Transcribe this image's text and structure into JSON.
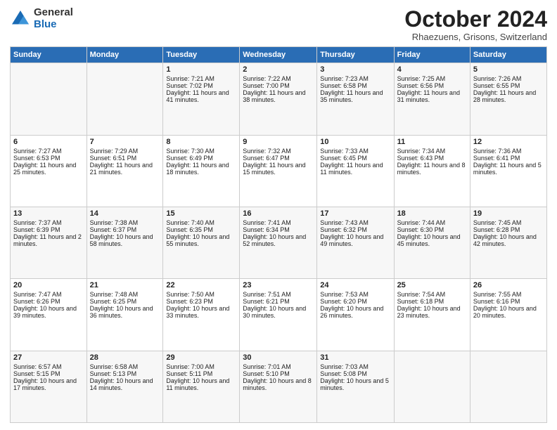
{
  "logo": {
    "general": "General",
    "blue": "Blue"
  },
  "title": "October 2024",
  "subtitle": "Rhaezuens, Grisons, Switzerland",
  "days_header": [
    "Sunday",
    "Monday",
    "Tuesday",
    "Wednesday",
    "Thursday",
    "Friday",
    "Saturday"
  ],
  "weeks": [
    [
      {
        "day": "",
        "info": ""
      },
      {
        "day": "",
        "info": ""
      },
      {
        "day": "1",
        "info": "Sunrise: 7:21 AM\nSunset: 7:02 PM\nDaylight: 11 hours and 41 minutes."
      },
      {
        "day": "2",
        "info": "Sunrise: 7:22 AM\nSunset: 7:00 PM\nDaylight: 11 hours and 38 minutes."
      },
      {
        "day": "3",
        "info": "Sunrise: 7:23 AM\nSunset: 6:58 PM\nDaylight: 11 hours and 35 minutes."
      },
      {
        "day": "4",
        "info": "Sunrise: 7:25 AM\nSunset: 6:56 PM\nDaylight: 11 hours and 31 minutes."
      },
      {
        "day": "5",
        "info": "Sunrise: 7:26 AM\nSunset: 6:55 PM\nDaylight: 11 hours and 28 minutes."
      }
    ],
    [
      {
        "day": "6",
        "info": "Sunrise: 7:27 AM\nSunset: 6:53 PM\nDaylight: 11 hours and 25 minutes."
      },
      {
        "day": "7",
        "info": "Sunrise: 7:29 AM\nSunset: 6:51 PM\nDaylight: 11 hours and 21 minutes."
      },
      {
        "day": "8",
        "info": "Sunrise: 7:30 AM\nSunset: 6:49 PM\nDaylight: 11 hours and 18 minutes."
      },
      {
        "day": "9",
        "info": "Sunrise: 7:32 AM\nSunset: 6:47 PM\nDaylight: 11 hours and 15 minutes."
      },
      {
        "day": "10",
        "info": "Sunrise: 7:33 AM\nSunset: 6:45 PM\nDaylight: 11 hours and 11 minutes."
      },
      {
        "day": "11",
        "info": "Sunrise: 7:34 AM\nSunset: 6:43 PM\nDaylight: 11 hours and 8 minutes."
      },
      {
        "day": "12",
        "info": "Sunrise: 7:36 AM\nSunset: 6:41 PM\nDaylight: 11 hours and 5 minutes."
      }
    ],
    [
      {
        "day": "13",
        "info": "Sunrise: 7:37 AM\nSunset: 6:39 PM\nDaylight: 11 hours and 2 minutes."
      },
      {
        "day": "14",
        "info": "Sunrise: 7:38 AM\nSunset: 6:37 PM\nDaylight: 10 hours and 58 minutes."
      },
      {
        "day": "15",
        "info": "Sunrise: 7:40 AM\nSunset: 6:35 PM\nDaylight: 10 hours and 55 minutes."
      },
      {
        "day": "16",
        "info": "Sunrise: 7:41 AM\nSunset: 6:34 PM\nDaylight: 10 hours and 52 minutes."
      },
      {
        "day": "17",
        "info": "Sunrise: 7:43 AM\nSunset: 6:32 PM\nDaylight: 10 hours and 49 minutes."
      },
      {
        "day": "18",
        "info": "Sunrise: 7:44 AM\nSunset: 6:30 PM\nDaylight: 10 hours and 45 minutes."
      },
      {
        "day": "19",
        "info": "Sunrise: 7:45 AM\nSunset: 6:28 PM\nDaylight: 10 hours and 42 minutes."
      }
    ],
    [
      {
        "day": "20",
        "info": "Sunrise: 7:47 AM\nSunset: 6:26 PM\nDaylight: 10 hours and 39 minutes."
      },
      {
        "day": "21",
        "info": "Sunrise: 7:48 AM\nSunset: 6:25 PM\nDaylight: 10 hours and 36 minutes."
      },
      {
        "day": "22",
        "info": "Sunrise: 7:50 AM\nSunset: 6:23 PM\nDaylight: 10 hours and 33 minutes."
      },
      {
        "day": "23",
        "info": "Sunrise: 7:51 AM\nSunset: 6:21 PM\nDaylight: 10 hours and 30 minutes."
      },
      {
        "day": "24",
        "info": "Sunrise: 7:53 AM\nSunset: 6:20 PM\nDaylight: 10 hours and 26 minutes."
      },
      {
        "day": "25",
        "info": "Sunrise: 7:54 AM\nSunset: 6:18 PM\nDaylight: 10 hours and 23 minutes."
      },
      {
        "day": "26",
        "info": "Sunrise: 7:55 AM\nSunset: 6:16 PM\nDaylight: 10 hours and 20 minutes."
      }
    ],
    [
      {
        "day": "27",
        "info": "Sunrise: 6:57 AM\nSunset: 5:15 PM\nDaylight: 10 hours and 17 minutes."
      },
      {
        "day": "28",
        "info": "Sunrise: 6:58 AM\nSunset: 5:13 PM\nDaylight: 10 hours and 14 minutes."
      },
      {
        "day": "29",
        "info": "Sunrise: 7:00 AM\nSunset: 5:11 PM\nDaylight: 10 hours and 11 minutes."
      },
      {
        "day": "30",
        "info": "Sunrise: 7:01 AM\nSunset: 5:10 PM\nDaylight: 10 hours and 8 minutes."
      },
      {
        "day": "31",
        "info": "Sunrise: 7:03 AM\nSunset: 5:08 PM\nDaylight: 10 hours and 5 minutes."
      },
      {
        "day": "",
        "info": ""
      },
      {
        "day": "",
        "info": ""
      }
    ]
  ]
}
